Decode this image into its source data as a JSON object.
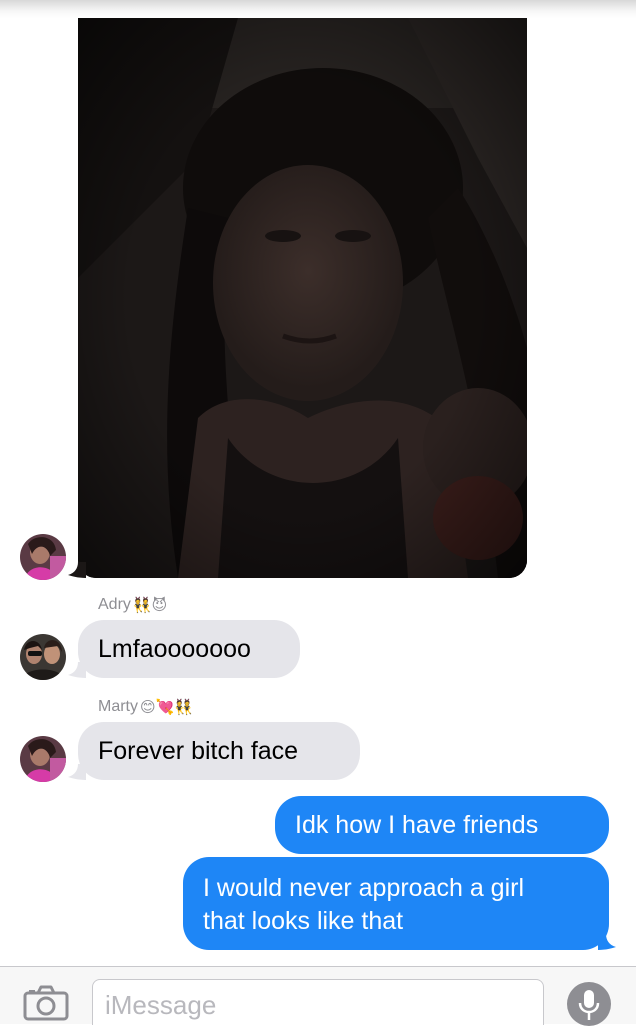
{
  "colors": {
    "incoming_bubble": "#e5e5ea",
    "outgoing_bubble": "#1e86f6",
    "sender_name": "#8e8e93",
    "placeholder": "#b8b8bd"
  },
  "messages": [
    {
      "type": "photo",
      "direction": "incoming",
      "avatar_icon": "avatar-icon"
    },
    {
      "type": "text",
      "direction": "incoming",
      "sender": "Adry",
      "sender_emoji": "👯😈",
      "text": "Lmfaooooooo",
      "avatar_icon": "avatar-icon"
    },
    {
      "type": "text",
      "direction": "incoming",
      "sender": "Marty",
      "sender_emoji": "😊💘👯",
      "text": "Forever bitch face",
      "avatar_icon": "avatar-icon"
    },
    {
      "type": "text",
      "direction": "outgoing",
      "text": "Idk how I have friends"
    },
    {
      "type": "text",
      "direction": "outgoing",
      "lines": [
        "I would never approach a girl",
        "that looks like that"
      ]
    }
  ],
  "input_bar": {
    "placeholder": "iMessage",
    "camera_icon": "camera-icon",
    "mic_icon": "microphone-icon"
  }
}
